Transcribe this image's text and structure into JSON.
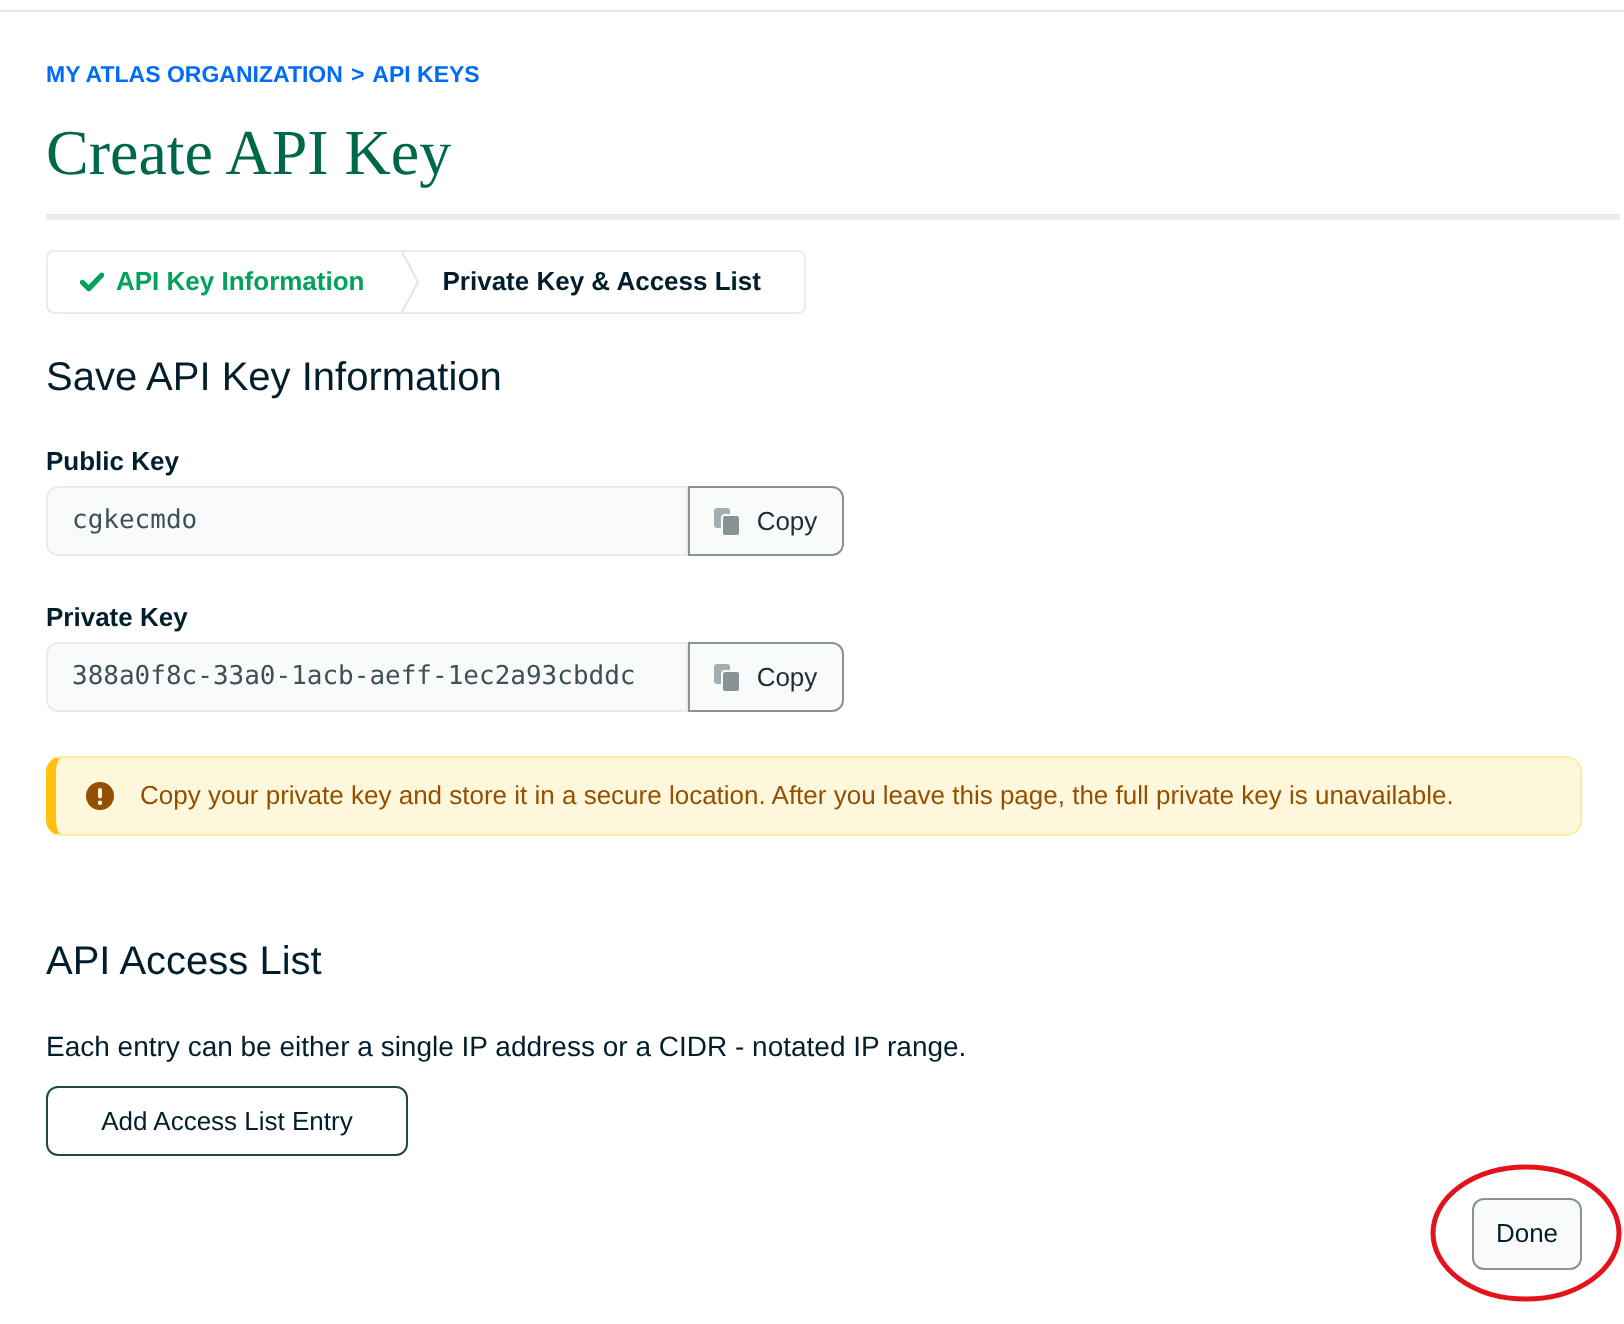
{
  "breadcrumb": {
    "items": [
      "MY ATLAS ORGANIZATION",
      "API KEYS"
    ],
    "separator": ">"
  },
  "page_title": "Create API Key",
  "stepper": [
    {
      "label": "API Key Information",
      "completed": true
    },
    {
      "label": "Private Key & Access List",
      "completed": false
    }
  ],
  "save_section": {
    "heading": "Save API Key Information",
    "fields": [
      {
        "label": "Public Key",
        "value": "cgkecmdo",
        "button": "Copy"
      },
      {
        "label": "Private Key",
        "value": "388a0f8c-33a0-1acb-aeff-1ec2a93cbddc",
        "button": "Copy"
      }
    ]
  },
  "warning_banner": {
    "text": "Copy your private key and store it in a secure location. After you leave this page, the full private key is unavailable."
  },
  "access_list": {
    "heading": "API Access List",
    "description": "Each entry can be either a single IP address or a CIDR - notated IP range.",
    "button": "Add Access List Entry"
  },
  "done_button": {
    "label": "Done",
    "circled": true
  }
}
